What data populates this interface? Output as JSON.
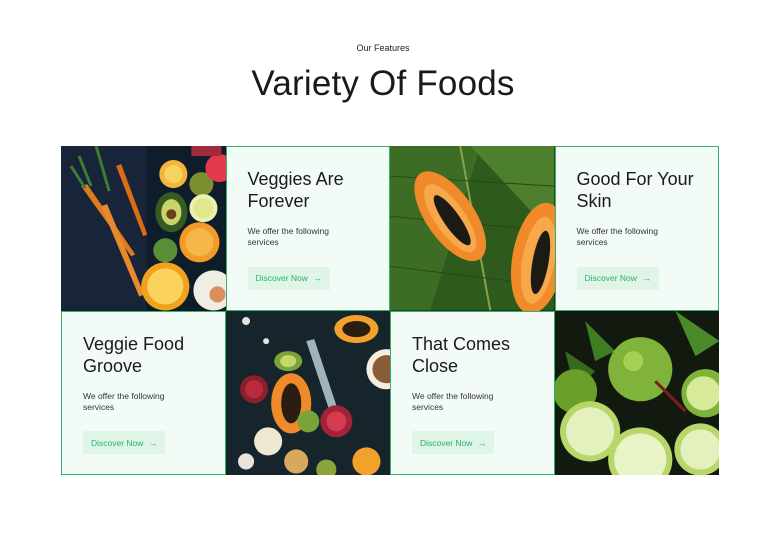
{
  "header": {
    "eyebrow": "Our Features",
    "title": "Variety Of Foods"
  },
  "cards": [
    {
      "title": "Veggies Are Forever",
      "desc": "We offer the following services",
      "button": "Discover Now"
    },
    {
      "title": "Good For Your Skin",
      "desc": "We offer the following services",
      "button": "Discover Now"
    },
    {
      "title": "Veggie Food Groove",
      "desc": "We offer the following services",
      "button": "Discover Now"
    },
    {
      "title": "That Comes Close",
      "desc": "We offer the following services",
      "button": "Discover Now"
    }
  ],
  "colors": {
    "accent": "#2fb36d",
    "card_bg": "#f2fbf6",
    "button_bg": "#dff5e8"
  }
}
